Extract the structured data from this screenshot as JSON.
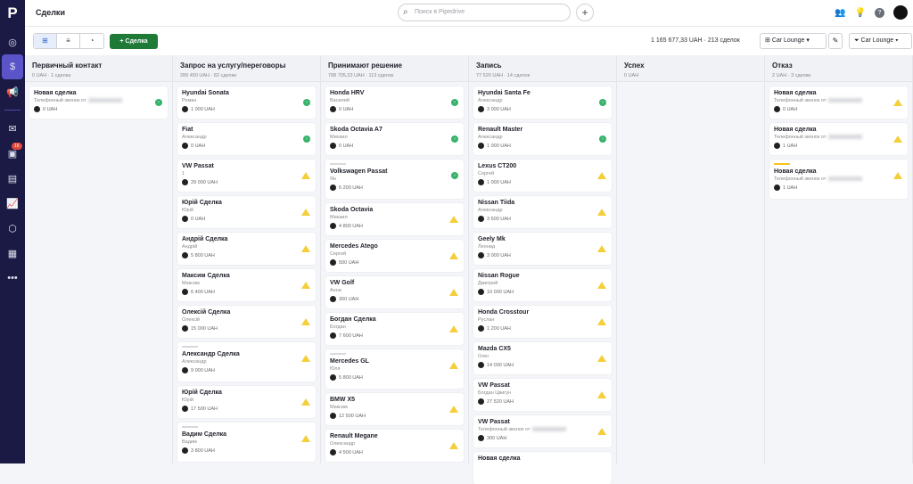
{
  "app": {
    "logo": "P",
    "title": "Сделки",
    "search_placeholder": "Поиск в Pipedrive",
    "sidebar_badge": "16"
  },
  "toolbar": {
    "add_label": "+ Сделка",
    "summary": "1 165 677,33 UAH · 213 сделок",
    "pipeline": "Car Lounge",
    "filter": "Car Lounge"
  },
  "columns": [
    {
      "name": "Первичный контакт",
      "meta": "0 UAH · 1 сделка",
      "cards": [
        {
          "title": "Новая сделка",
          "sub": "Телефонный звонок от",
          "blur": true,
          "amount": "0 UAH",
          "status": "ok"
        }
      ]
    },
    {
      "name": "Запрос на услугу/переговоры",
      "meta": "289 450 UAH · 82 сделки",
      "cards": [
        {
          "title": "Hyundai Sonata",
          "sub": "Роман",
          "amount": "1 000 UAH",
          "status": "ok"
        },
        {
          "title": "Fiat",
          "sub": "Александр",
          "amount": "0 UAH",
          "status": "ok"
        },
        {
          "title": "VW Passat",
          "sub": "1",
          "amount": "29 000 UAH",
          "status": "warn"
        },
        {
          "title": "Юрій Сделка",
          "sub": "Юрій",
          "amount": "0 UAH",
          "status": "warn"
        },
        {
          "title": "Андрій Сделка",
          "sub": "Андрій",
          "amount": "5 800 UAH",
          "status": "warn"
        },
        {
          "title": "Максим Сделка",
          "sub": "Максим",
          "amount": "6 400 UAH",
          "status": "warn"
        },
        {
          "title": "Олексій Сделка",
          "sub": "Олексій",
          "amount": "15 000 UAH",
          "status": "warn"
        },
        {
          "title": "Александр Сделка",
          "sub": "Александр",
          "amount": "9 000 UAH",
          "status": "warn",
          "stripe": true
        },
        {
          "title": "Юрій Сделка",
          "sub": "Юрій",
          "amount": "17 500 UAH",
          "status": "warn"
        },
        {
          "title": "Вадим Сделка",
          "sub": "Вадим",
          "amount": "3 800 UAH",
          "status": "warn",
          "stripe": true
        }
      ]
    },
    {
      "name": "Принимают решение",
      "meta": "798 705,33 UAH · 113 сделок",
      "cards": [
        {
          "title": "Honda HRV",
          "sub": "Василий",
          "amount": "0 UAH",
          "status": "ok"
        },
        {
          "title": "Skoda Octavia A7",
          "sub": "Михаил",
          "amount": "0 UAH",
          "status": "ok"
        },
        {
          "title": "Volkswagen Passat",
          "sub": "Ян",
          "amount": "6 200 UAH",
          "status": "ok",
          "stripe": true
        },
        {
          "title": "Skoda Octavia",
          "sub": "Михаил",
          "amount": "4 800 UAH",
          "status": "warn"
        },
        {
          "title": "Mercedes Atego",
          "sub": "Сергей",
          "amount": "500 UAH",
          "status": "warn"
        },
        {
          "title": "VW Golf",
          "sub": "Анна",
          "amount": "300 UAH",
          "status": "warn"
        },
        {
          "title": "Богдан Сделка",
          "sub": "Богдан",
          "amount": "7 600 UAH",
          "status": "warn"
        },
        {
          "title": "Mercedes GL",
          "sub": "Юля",
          "amount": "5 800 UAH",
          "status": "warn",
          "stripe": true
        },
        {
          "title": "BMW X5",
          "sub": "Максим",
          "amount": "12 500 UAH",
          "status": "warn"
        },
        {
          "title": "Renault Megane",
          "sub": "Олександр",
          "amount": "4 500 UAH",
          "status": "warn"
        }
      ]
    },
    {
      "name": "Запись",
      "meta": "77 520 UAH · 14 сделок",
      "cards": [
        {
          "title": "Hyundai Santa Fe",
          "sub": "Александр",
          "amount": "3 000 UAH",
          "status": "ok"
        },
        {
          "title": "Renault Master",
          "sub": "Александр",
          "amount": "1 000 UAH",
          "status": "ok"
        },
        {
          "title": "Lexus CT200",
          "sub": "Сергей",
          "amount": "1 000 UAH",
          "status": "warn"
        },
        {
          "title": "Nissan Tiida",
          "sub": "Александр",
          "amount": "3 600 UAH",
          "status": "warn"
        },
        {
          "title": "Geely Mk",
          "sub": "Леонид",
          "amount": "3 000 UAH",
          "status": "warn"
        },
        {
          "title": "Nissan Rogue",
          "sub": "Дмитрий",
          "amount": "10 000 UAH",
          "status": "warn"
        },
        {
          "title": "Honda Crosstour",
          "sub": "Руслан",
          "amount": "1 200 UAH",
          "status": "warn"
        },
        {
          "title": "Mazda CX5",
          "sub": "Олег",
          "amount": "14 000 UAH",
          "status": "warn"
        },
        {
          "title": "VW Passat",
          "sub": "Богдан Цвигун",
          "amount": "27 520 UAH",
          "status": "warn"
        },
        {
          "title": "VW Passat",
          "sub": "Телефонный звонок от",
          "blur": true,
          "amount": "300 UAH",
          "status": "warn"
        },
        {
          "title": "Новая сделка",
          "sub": "",
          "amount": "",
          "status": ""
        }
      ]
    },
    {
      "name": "Успех",
      "meta": "0 UAH",
      "cards": []
    },
    {
      "name": "Отказ",
      "meta": "2 UAH · 3 сделки",
      "cards": [
        {
          "title": "Новая сделка",
          "sub": "Телефонный звонок от",
          "blur": true,
          "amount": "0 UAH",
          "status": "warn"
        },
        {
          "title": "Новая сделка",
          "sub": "Телефонный звонок от",
          "blur": true,
          "amount": "1 UAH",
          "status": "warn"
        },
        {
          "title": "Новая сделка",
          "sub": "Телефонный звонок от",
          "blur": true,
          "amount": "1 UAH",
          "status": "warn",
          "stripe": true,
          "stripe_color": "#f5c518"
        }
      ]
    }
  ]
}
